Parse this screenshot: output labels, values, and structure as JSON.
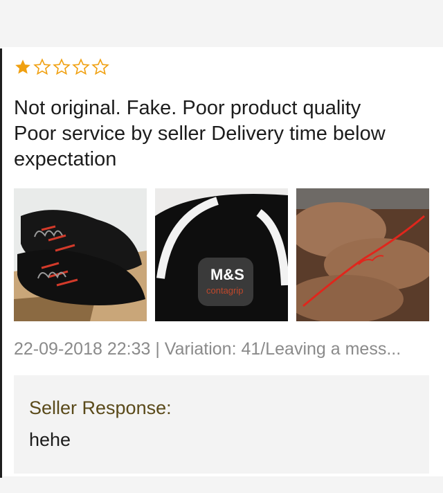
{
  "review": {
    "rating": 1,
    "max_rating": 5,
    "star_color": "#f0a010",
    "text_lines": [
      "Not original. Fake. Poor product quality",
      "Poor service by seller  Delivery time below",
      "expectation"
    ],
    "photos": [
      {
        "icon": "shoes-photo"
      },
      {
        "icon": "shoe-logo-photo",
        "logo_text": "M&S",
        "logo_subtext": "contagrip"
      },
      {
        "icon": "hand-red-lace-photo"
      }
    ],
    "meta": "22-09-2018 22:33 | Variation: 41/Leaving a mess..."
  },
  "seller_response": {
    "title": "Seller Response:",
    "text": "hehe"
  }
}
